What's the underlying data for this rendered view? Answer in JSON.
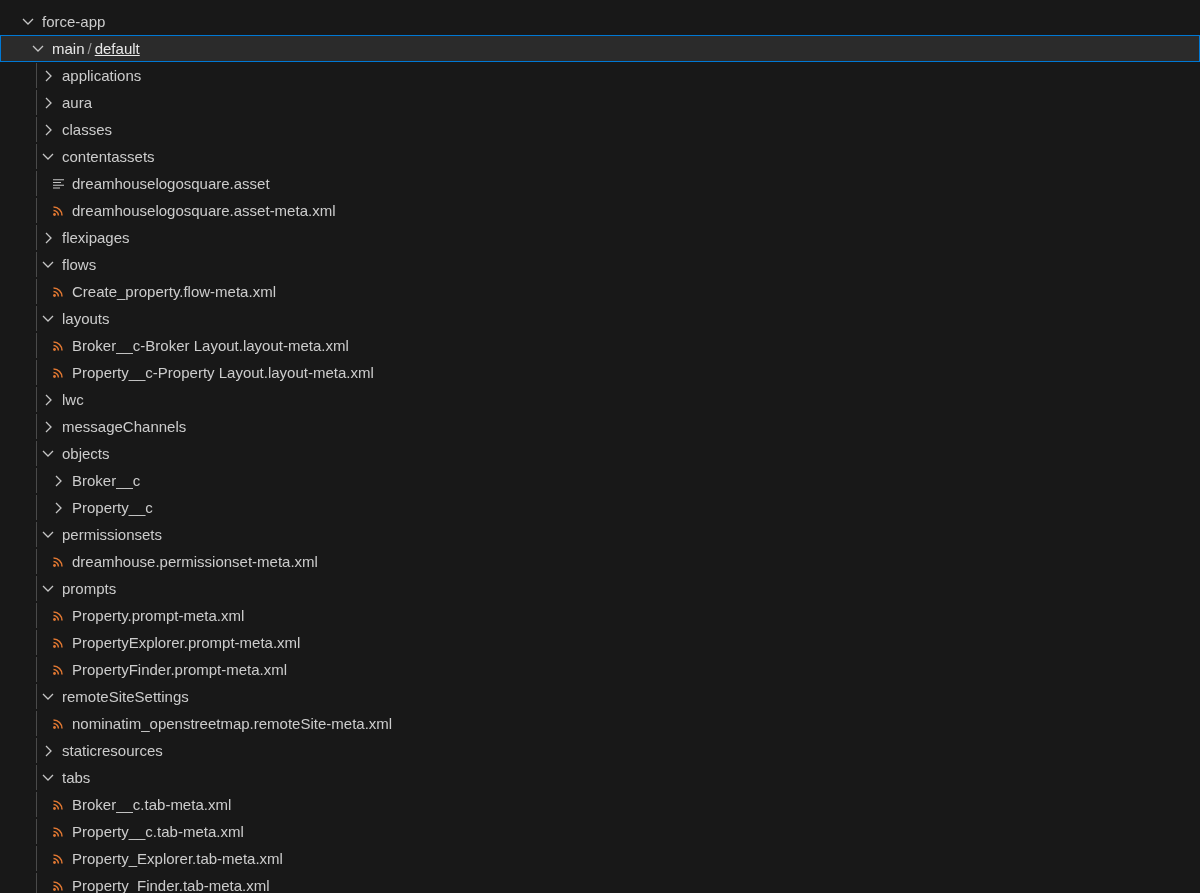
{
  "explorer": {
    "tree": [
      {
        "kind": "folder",
        "name": "force-app",
        "expanded": true,
        "selected": false,
        "children": [
          {
            "kind": "folder",
            "segments": [
              {
                "label": "main",
                "underlined": false
              },
              {
                "label": "default",
                "underlined": true
              }
            ],
            "separator": "/",
            "expanded": true,
            "selected": true,
            "children": [
              {
                "kind": "folder",
                "name": "applications",
                "expanded": false,
                "selected": false
              },
              {
                "kind": "folder",
                "name": "aura",
                "expanded": false,
                "selected": false
              },
              {
                "kind": "folder",
                "name": "classes",
                "expanded": false,
                "selected": false
              },
              {
                "kind": "folder",
                "name": "contentassets",
                "expanded": true,
                "selected": false,
                "children": [
                  {
                    "kind": "text-file",
                    "name": "dreamhouselogosquare.asset",
                    "selected": false
                  },
                  {
                    "kind": "xml-file",
                    "name": "dreamhouselogosquare.asset-meta.xml",
                    "selected": false
                  }
                ]
              },
              {
                "kind": "folder",
                "name": "flexipages",
                "expanded": false,
                "selected": false
              },
              {
                "kind": "folder",
                "name": "flows",
                "expanded": true,
                "selected": false,
                "children": [
                  {
                    "kind": "xml-file",
                    "name": "Create_property.flow-meta.xml",
                    "selected": false
                  }
                ]
              },
              {
                "kind": "folder",
                "name": "layouts",
                "expanded": true,
                "selected": false,
                "children": [
                  {
                    "kind": "xml-file",
                    "name": "Broker__c-Broker Layout.layout-meta.xml",
                    "selected": false
                  },
                  {
                    "kind": "xml-file",
                    "name": "Property__c-Property Layout.layout-meta.xml",
                    "selected": false
                  }
                ]
              },
              {
                "kind": "folder",
                "name": "lwc",
                "expanded": false,
                "selected": false
              },
              {
                "kind": "folder",
                "name": "messageChannels",
                "expanded": false,
                "selected": false
              },
              {
                "kind": "folder",
                "name": "objects",
                "expanded": true,
                "selected": false,
                "children": [
                  {
                    "kind": "folder",
                    "name": "Broker__c",
                    "expanded": false,
                    "selected": false
                  },
                  {
                    "kind": "folder",
                    "name": "Property__c",
                    "expanded": false,
                    "selected": false
                  }
                ]
              },
              {
                "kind": "folder",
                "name": "permissionsets",
                "expanded": true,
                "selected": false,
                "children": [
                  {
                    "kind": "xml-file",
                    "name": "dreamhouse.permissionset-meta.xml",
                    "selected": false
                  }
                ]
              },
              {
                "kind": "folder",
                "name": "prompts",
                "expanded": true,
                "selected": false,
                "children": [
                  {
                    "kind": "xml-file",
                    "name": "Property.prompt-meta.xml",
                    "selected": false
                  },
                  {
                    "kind": "xml-file",
                    "name": "PropertyExplorer.prompt-meta.xml",
                    "selected": false
                  },
                  {
                    "kind": "xml-file",
                    "name": "PropertyFinder.prompt-meta.xml",
                    "selected": false
                  }
                ]
              },
              {
                "kind": "folder",
                "name": "remoteSiteSettings",
                "expanded": true,
                "selected": false,
                "children": [
                  {
                    "kind": "xml-file",
                    "name": "nominatim_openstreetmap.remoteSite-meta.xml",
                    "selected": false
                  }
                ]
              },
              {
                "kind": "folder",
                "name": "staticresources",
                "expanded": false,
                "selected": false
              },
              {
                "kind": "folder",
                "name": "tabs",
                "expanded": true,
                "selected": false,
                "children": [
                  {
                    "kind": "xml-file",
                    "name": "Broker__c.tab-meta.xml",
                    "selected": false
                  },
                  {
                    "kind": "xml-file",
                    "name": "Property__c.tab-meta.xml",
                    "selected": false
                  },
                  {
                    "kind": "xml-file",
                    "name": "Property_Explorer.tab-meta.xml",
                    "selected": false
                  },
                  {
                    "kind": "xml-file",
                    "name": "Property_Finder.tab-meta.xml",
                    "selected": false
                  }
                ]
              }
            ]
          }
        ]
      }
    ]
  }
}
